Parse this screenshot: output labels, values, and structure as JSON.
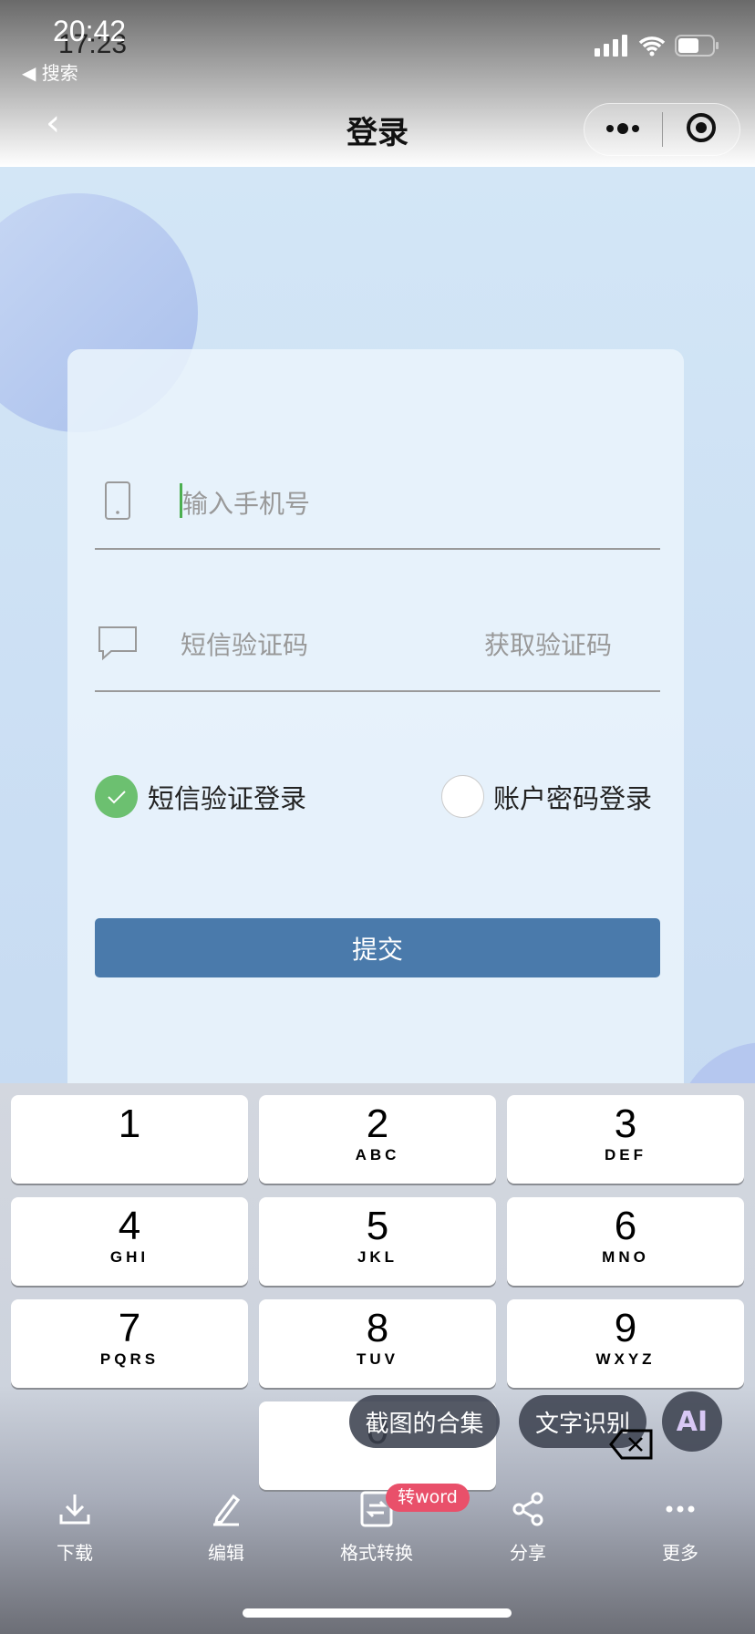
{
  "status_bar": {
    "time_overlay": "20:42",
    "time": "17:23",
    "back_app": "◀ 搜索"
  },
  "nav": {
    "title": "登录"
  },
  "form": {
    "phone_placeholder": "输入手机号",
    "sms_placeholder": "短信验证码",
    "get_code": "获取验证码",
    "radio_sms": {
      "label": "短信验证登录",
      "checked": true
    },
    "radio_password": {
      "label": "账户密码登录",
      "checked": false
    },
    "submit": "提交"
  },
  "colors": {
    "accent": "#4a7aab",
    "check": "#6cc070",
    "badge": "#e9506a"
  },
  "keypad": [
    {
      "n": "1",
      "l": ""
    },
    {
      "n": "2",
      "l": "ABC"
    },
    {
      "n": "3",
      "l": "DEF"
    },
    {
      "n": "4",
      "l": "GHI"
    },
    {
      "n": "5",
      "l": "JKL"
    },
    {
      "n": "6",
      "l": "MNO"
    },
    {
      "n": "7",
      "l": "PQRS"
    },
    {
      "n": "8",
      "l": "TUV"
    },
    {
      "n": "9",
      "l": "WXYZ"
    },
    {
      "n": "0",
      "l": ""
    }
  ],
  "overlay": {
    "collection": "截图的合集",
    "ocr": "文字识别",
    "ai": "AI",
    "badge": "转word"
  },
  "toolbar": [
    {
      "label": "下载",
      "icon": "download-icon"
    },
    {
      "label": "编辑",
      "icon": "edit-icon"
    },
    {
      "label": "格式转换",
      "icon": "convert-icon"
    },
    {
      "label": "分享",
      "icon": "share-icon"
    },
    {
      "label": "更多",
      "icon": "more-icon"
    }
  ]
}
